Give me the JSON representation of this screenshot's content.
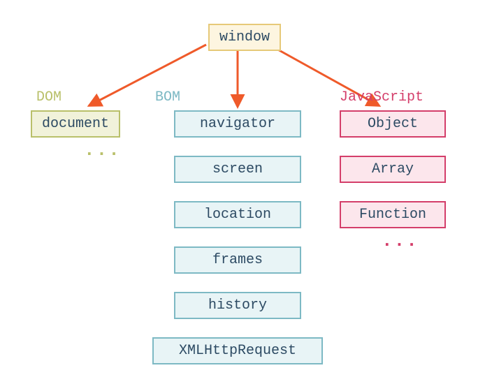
{
  "root": {
    "label": "window"
  },
  "dom": {
    "section_label": "DOM",
    "items": [
      "document"
    ],
    "ellipsis": "..."
  },
  "bom": {
    "section_label": "BOM",
    "items": [
      "navigator",
      "screen",
      "location",
      "frames",
      "history",
      "XMLHttpRequest"
    ]
  },
  "js": {
    "section_label": "JavaScript",
    "items": [
      "Object",
      "Array",
      "Function"
    ],
    "ellipsis": "..."
  },
  "colors": {
    "arrow": "#ef5a2a",
    "window_bg": "#fdf5e0",
    "window_border": "#e6c978",
    "dom_bg": "#f1f2da",
    "dom_border": "#b9c06a",
    "bom_bg": "#e8f4f6",
    "bom_border": "#7db9c4",
    "js_bg": "#fce6ec",
    "js_border": "#d43e6a",
    "text": "#2c4a63"
  }
}
